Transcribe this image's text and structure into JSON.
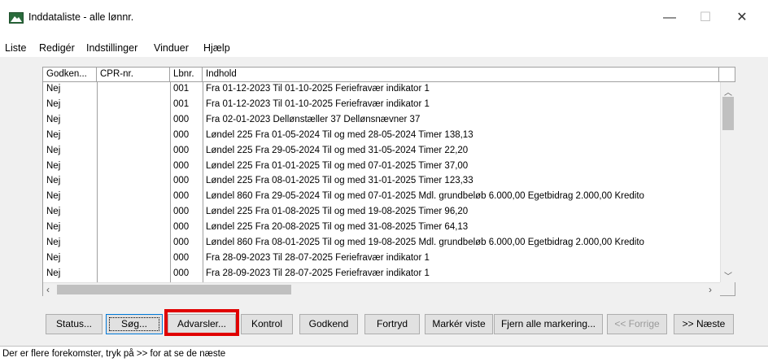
{
  "window": {
    "title": "Inddataliste - alle lønnr.",
    "minimize": "—",
    "maximize": "☐",
    "close": "✕"
  },
  "menu": [
    "Liste",
    "Redigér",
    "Indstillinger",
    "Vinduer",
    "Hjælp"
  ],
  "table": {
    "columns": [
      "Godken...",
      "CPR-nr.",
      "Lbnr.",
      "Indhold"
    ],
    "rows": [
      {
        "godkendt": "Nej",
        "cpr": "",
        "lbnr": "001",
        "indhold": "Fra 01-12-2023 Til 01-10-2025 Feriefravær indikator 1"
      },
      {
        "godkendt": "Nej",
        "cpr": "",
        "lbnr": "001",
        "indhold": "Fra 01-12-2023 Til 01-10-2025 Feriefravær indikator 1"
      },
      {
        "godkendt": "Nej",
        "cpr": "",
        "lbnr": "000",
        "indhold": "Fra 02-01-2023 Dellønstæller 37 Dellønsnævner 37"
      },
      {
        "godkendt": "Nej",
        "cpr": "",
        "lbnr": "000",
        "indhold": "Løndel 225 Fra 01-05-2024 Til og med 28-05-2024 Timer 138,13"
      },
      {
        "godkendt": "Nej",
        "cpr": "",
        "lbnr": "000",
        "indhold": "Løndel 225 Fra 29-05-2024 Til og med 31-05-2024 Timer 22,20"
      },
      {
        "godkendt": "Nej",
        "cpr": "",
        "lbnr": "000",
        "indhold": "Løndel 225 Fra 01-01-2025 Til og med 07-01-2025 Timer 37,00"
      },
      {
        "godkendt": "Nej",
        "cpr": "",
        "lbnr": "000",
        "indhold": "Løndel 225 Fra 08-01-2025 Til og med 31-01-2025 Timer 123,33"
      },
      {
        "godkendt": "Nej",
        "cpr": "",
        "lbnr": "000",
        "indhold": "Løndel 860 Fra 29-05-2024 Til og med 07-01-2025 Mdl. grundbeløb 6.000,00 Egetbidrag 2.000,00 Kredito"
      },
      {
        "godkendt": "Nej",
        "cpr": "",
        "lbnr": "000",
        "indhold": "Løndel 225 Fra 01-08-2025 Til og med 19-08-2025 Timer 96,20"
      },
      {
        "godkendt": "Nej",
        "cpr": "",
        "lbnr": "000",
        "indhold": "Løndel 225 Fra 20-08-2025 Til og med 31-08-2025 Timer 64,13"
      },
      {
        "godkendt": "Nej",
        "cpr": "",
        "lbnr": "000",
        "indhold": "Løndel 860 Fra 08-01-2025 Til og med 19-08-2025 Mdl. grundbeløb 6.000,00 Egetbidrag 2.000,00 Kredito"
      },
      {
        "godkendt": "Nej",
        "cpr": "",
        "lbnr": "000",
        "indhold": "Fra 28-09-2023 Til 28-07-2025 Feriefravær indikator 1"
      },
      {
        "godkendt": "Nej",
        "cpr": "",
        "lbnr": "000",
        "indhold": "Fra 28-09-2023 Til 28-07-2025 Feriefravær indikator 1"
      }
    ]
  },
  "buttons": {
    "status": "Status...",
    "sog": "Søg...",
    "advarsler": "Advarsler...",
    "kontrol": "Kontrol",
    "godkend": "Godkend",
    "fortryd": "Fortryd",
    "marker_viste": "Markér viste",
    "fjern_alle": "Fjern alle markering...",
    "forrige": "<< Forrige",
    "naeste": ">> Næste"
  },
  "status_text": "Der er flere forekomster, tryk på >> for at se de næste",
  "colors": {
    "highlight": "#e00000",
    "panel": "#f0f0f0"
  }
}
